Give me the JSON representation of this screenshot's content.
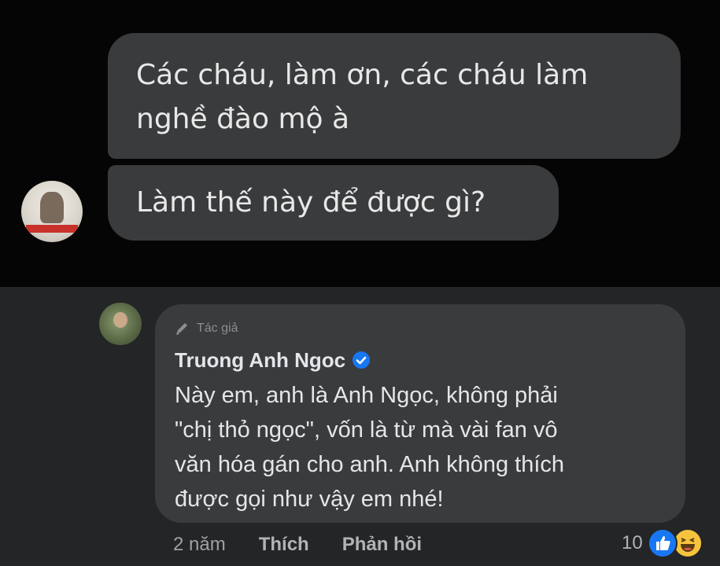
{
  "chat": {
    "messages": [
      {
        "line1": "Các cháu, làm ơn, các cháu làm",
        "line2": "nghề đào mộ à"
      },
      {
        "line1": "Làm thế này để được gì?"
      }
    ],
    "sender_avatar": "avatar"
  },
  "comment": {
    "badge": "Tác giả",
    "author": "Truong Anh Ngoc",
    "verified": true,
    "lines": [
      "Này em, anh là Anh Ngọc, không phải",
      "\"chị thỏ ngọc\", vốn là từ mà vài fan vô",
      "văn hóa gán cho anh. Anh không thích",
      "được gọi như vậy em nhé!"
    ],
    "time": "2 năm",
    "like_label": "Thích",
    "reply_label": "Phản hồi",
    "reaction_count": "10",
    "reactions": [
      "like-icon",
      "haha-icon"
    ]
  },
  "colors": {
    "chat_bg": "#050505",
    "bubble": "#3a3b3d",
    "comment_bg": "#242526",
    "comment_bubble": "#3a3b3c",
    "verified": "#1877f2"
  }
}
